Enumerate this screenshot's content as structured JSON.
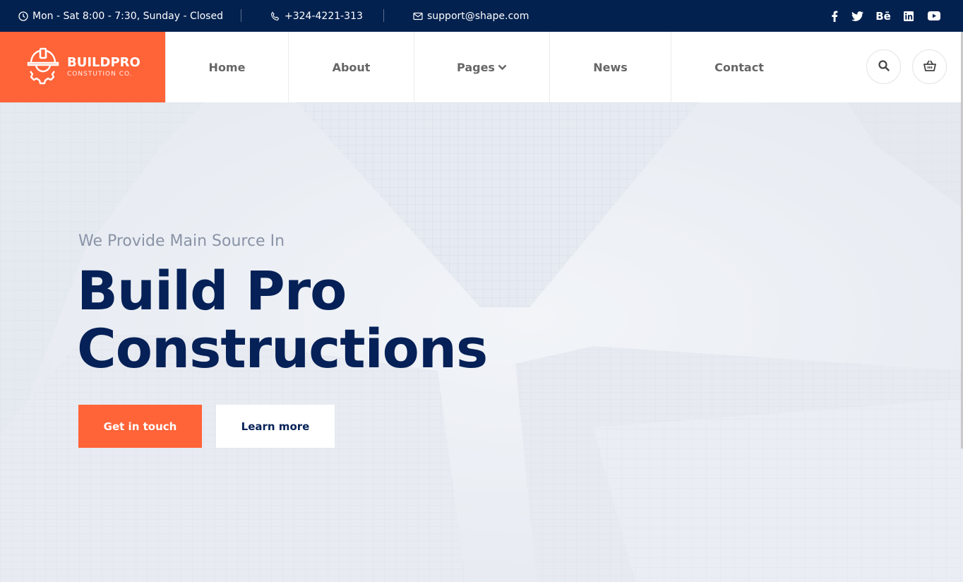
{
  "topbar": {
    "hours": "Mon - Sat 8:00 - 7:30, Sunday - Closed",
    "phone": "+324-4221-313",
    "email": "support@shape.com",
    "social": [
      "facebook-icon",
      "twitter-icon",
      "behance-icon",
      "linkedin-icon",
      "youtube-icon"
    ],
    "behance_label": "Bē"
  },
  "logo": {
    "name": "BUILDPRO",
    "tagline": "CONSTUTION CO."
  },
  "nav": {
    "items": [
      {
        "label": "Home"
      },
      {
        "label": "About"
      },
      {
        "label": "Pages",
        "has_dropdown": true
      },
      {
        "label": "News"
      },
      {
        "label": "Contact"
      }
    ]
  },
  "hero": {
    "subtitle": "We Provide Main Source In",
    "title_line1": "Build Pro",
    "title_line2": "Constructions",
    "primary_button": "Get in touch",
    "secondary_button": "Learn more"
  },
  "colors": {
    "topbar_bg": "#03214f",
    "accent": "#ff6338",
    "title": "#052157"
  }
}
